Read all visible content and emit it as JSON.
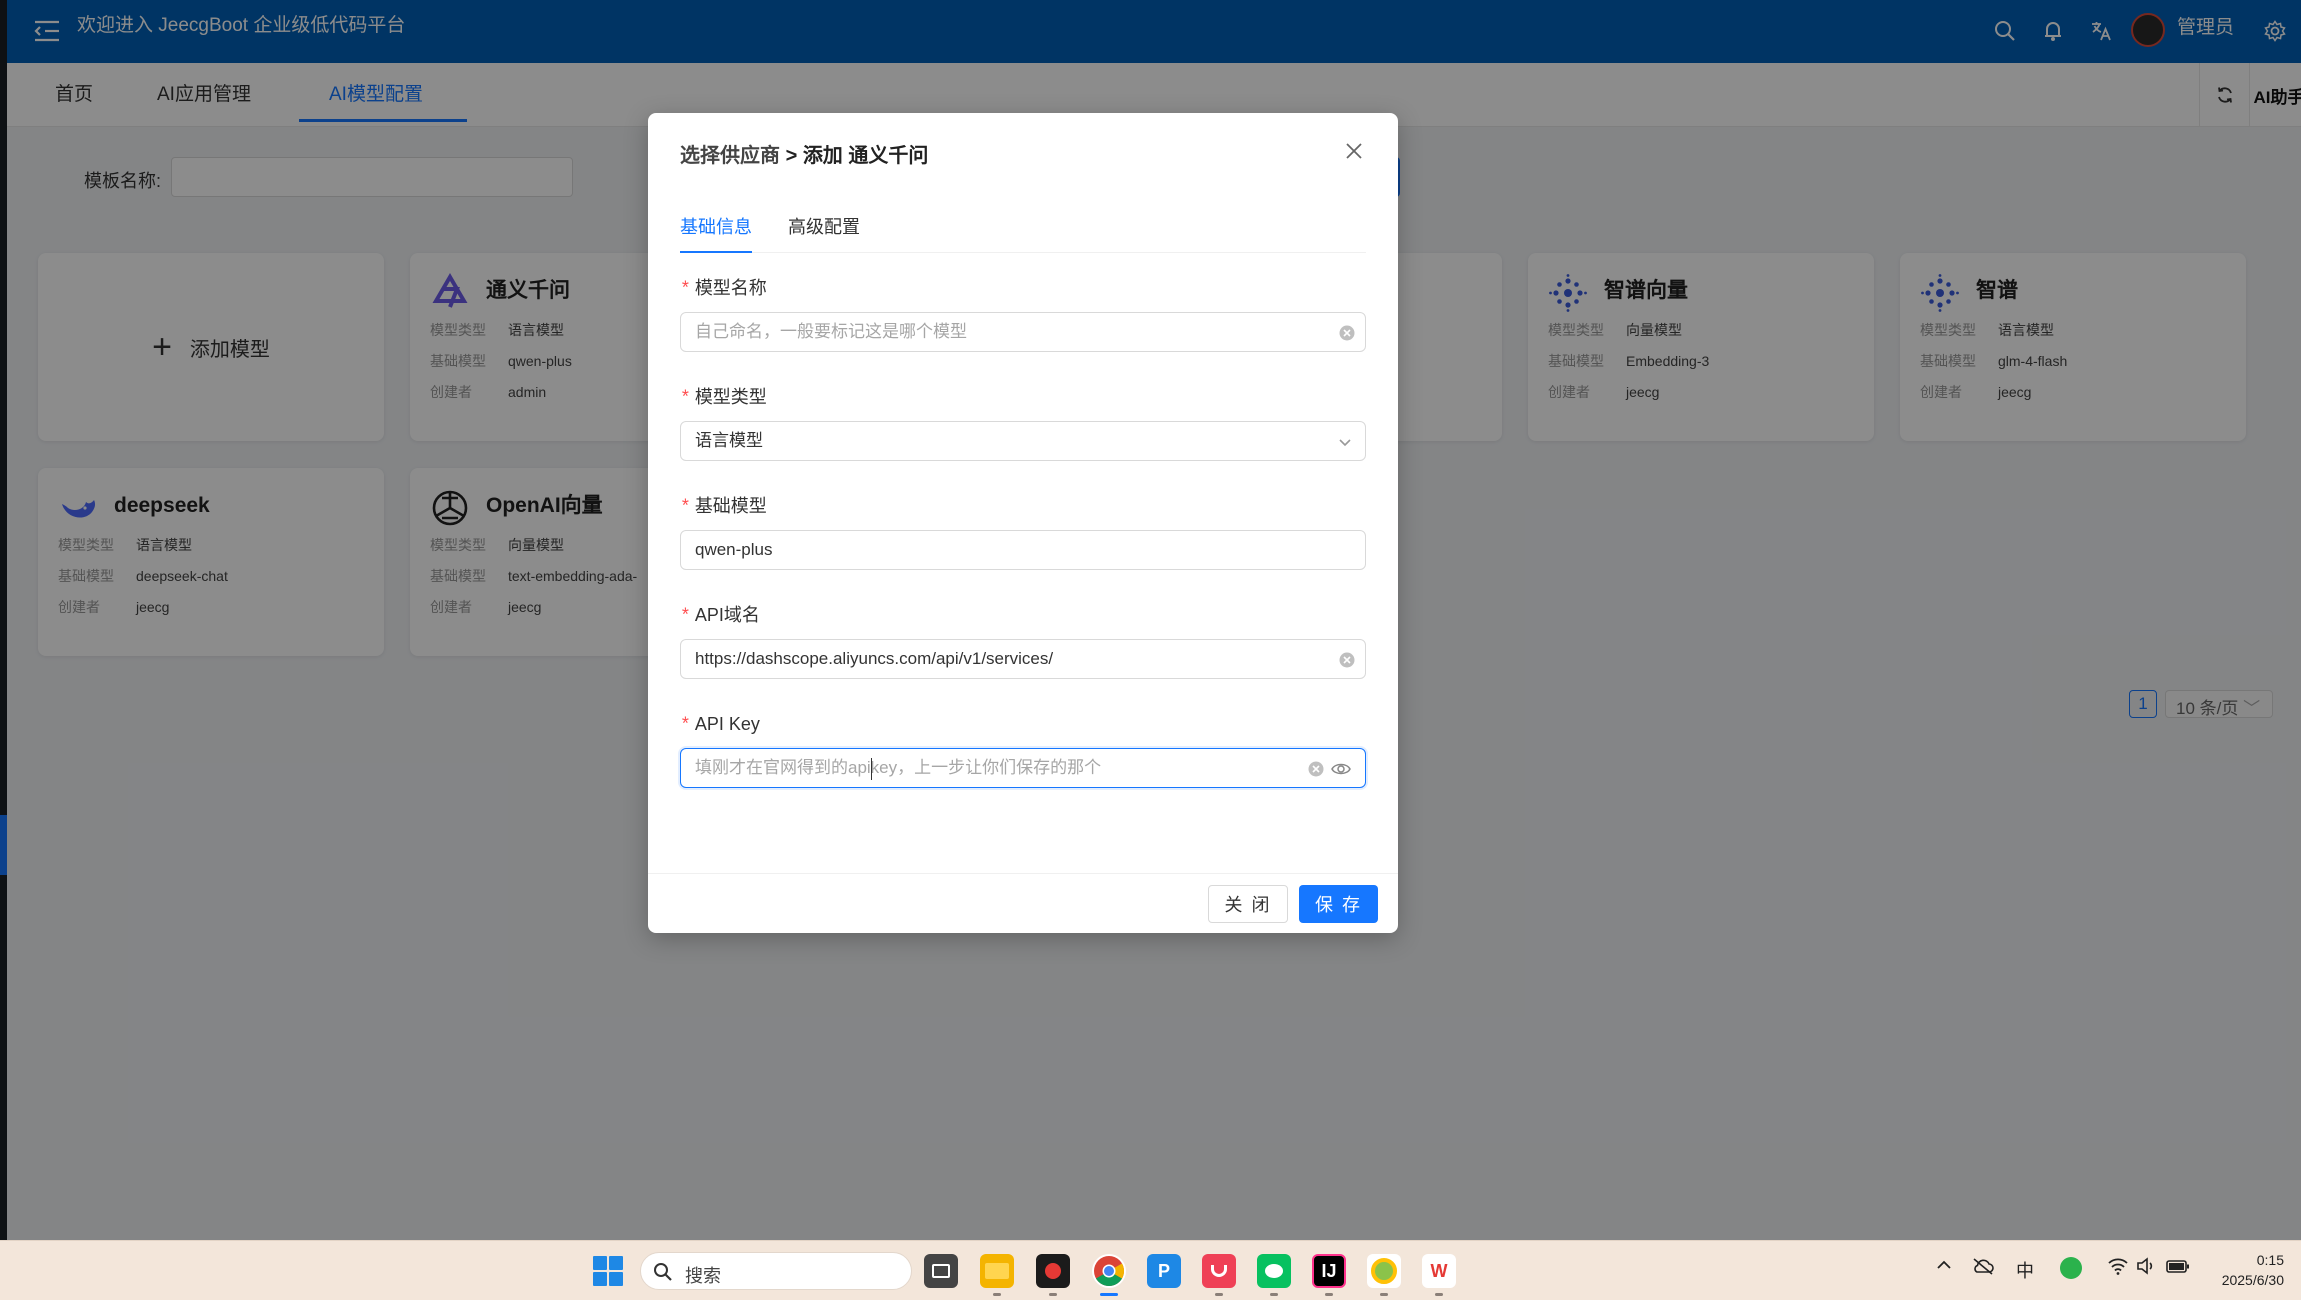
{
  "header": {
    "app_title": "欢迎进入 JeecgBoot 企业级低代码平台",
    "user_name": "管理员",
    "icons": [
      "menu-fold-icon",
      "search-icon",
      "bell-icon",
      "translate-icon",
      "settings-icon"
    ]
  },
  "tabs": [
    {
      "label": "首页",
      "active": false
    },
    {
      "label": "AI应用管理",
      "active": false
    },
    {
      "label": "AI模型配置",
      "active": true
    }
  ],
  "ai_helper_label": "AI助手",
  "filter": {
    "label": "模板名称:",
    "value": ""
  },
  "cards": {
    "add_label": "添加模型",
    "field_keys": {
      "type": "模型类型",
      "base": "基础模型",
      "creator": "创建者"
    },
    "items": [
      {
        "name": "通义千问",
        "type": "语言模型",
        "base": "qwen-plus",
        "creator": "admin"
      },
      {
        "name": "智谱向量",
        "type": "向量模型",
        "base": "Embedding-3",
        "creator": "jeecg"
      },
      {
        "name": "智谱",
        "type": "语言模型",
        "base": "glm-4-flash",
        "creator": "jeecg"
      },
      {
        "name": "deepseek",
        "type": "语言模型",
        "base": "deepseek-chat",
        "creator": "jeecg"
      },
      {
        "name": "OpenAI向量",
        "type": "向量模型",
        "base": "text-embedding-ada-",
        "creator": "jeecg"
      }
    ]
  },
  "pagination": {
    "current_page": "1",
    "page_size": "10 条/页"
  },
  "modal": {
    "breadcrumb": "选择供应商",
    "separator": ">",
    "title": "添加 通义千问",
    "tabs": [
      {
        "label": "基础信息",
        "active": true
      },
      {
        "label": "高级配置",
        "active": false
      }
    ],
    "fields": {
      "model_name": {
        "label": "模型名称",
        "value": "",
        "placeholder": "自己命名，一般要标记这是哪个模型"
      },
      "model_type": {
        "label": "模型类型",
        "value": "语言模型"
      },
      "base_model": {
        "label": "基础模型",
        "value": "qwen-plus"
      },
      "api_domain": {
        "label": "API域名",
        "value": "https://dashscope.aliyuncs.com/api/v1/services/"
      },
      "api_key": {
        "label": "API Key",
        "value": "",
        "placeholder": "填刚才在官网得到的apikey，上一步让你们保存的那个"
      }
    },
    "required_mark": "*",
    "buttons": {
      "close": "关 闭",
      "save": "保 存"
    }
  },
  "taskbar": {
    "search_placeholder": "搜索",
    "ime_indicator": "中",
    "time": "0:15",
    "date": "2025/6/30",
    "apps": [
      "file-explorer-icon",
      "video-editor-icon",
      "chrome-icon",
      "p-app-icon",
      "pocket-icon",
      "wechat-icon",
      "intellij-idea-icon",
      "qq-browser-icon",
      "wps-icon"
    ]
  },
  "colors": {
    "primary": "#1677ff",
    "header_bg": "#0060b6",
    "required": "#ff4d4f"
  }
}
